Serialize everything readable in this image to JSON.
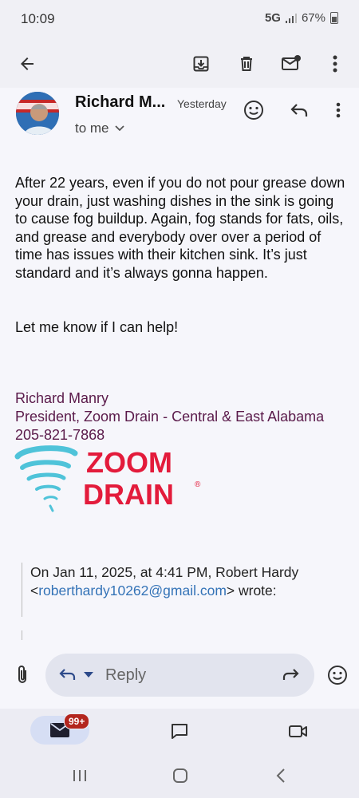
{
  "status": {
    "time": "10:09",
    "network": "5G",
    "battery": "67%"
  },
  "toolbar": {
    "back_icon": "arrow-left-icon",
    "archive_icon": "archive-icon",
    "delete_icon": "trash-icon",
    "unread_icon": "mark-unread-icon",
    "more_icon": "more-vert-icon"
  },
  "email": {
    "sender": "Richard M...",
    "date": "Yesterday",
    "to": "to me",
    "body": [
      "After 22 years, even if you do not pour grease down your drain, just washing dishes in the sink is going to cause fog buildup. Again, fog stands for fats, oils, and grease and everybody over over a period of time has issues with their kitchen sink. It’s just standard and it’s always gonna happen."
    ],
    "closing": "Let me know if I can help!",
    "signature": {
      "name": "Richard Manry",
      "title": "President, Zoom Drain - Central & East Alabama",
      "phone": "205-821-7868"
    },
    "logo": {
      "line1": "ZOOM",
      "line2": "DRAIN",
      "mark": "®",
      "color": "#e31b3b",
      "swirl_color": "#4fc3d9"
    },
    "quoted": {
      "prefix": "On Jan 11, 2025, at 4:41 PM, Robert Hardy <",
      "email": "roberthardy10262@gmail.com",
      "suffix": "> wrote:"
    }
  },
  "reply": {
    "placeholder": "Reply"
  },
  "bottom_nav": {
    "badge": "99+"
  }
}
